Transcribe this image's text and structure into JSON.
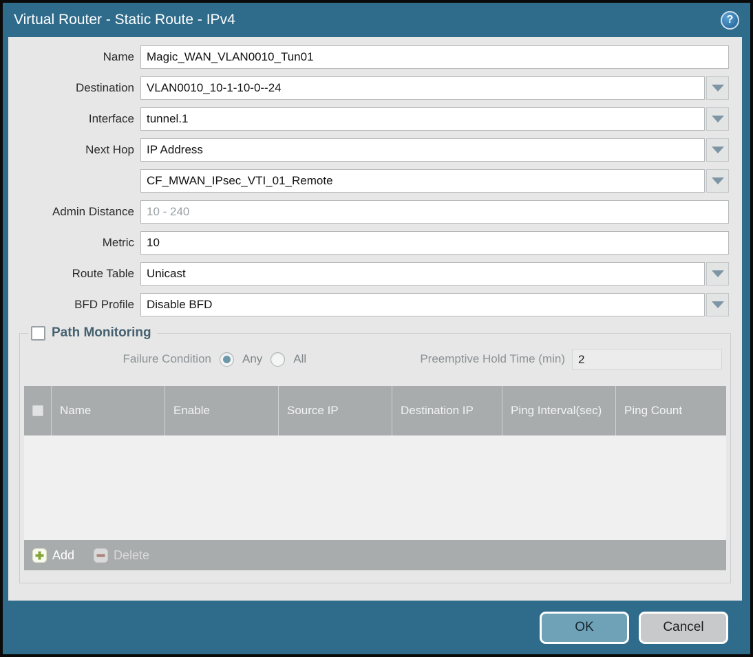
{
  "window": {
    "title": "Virtual Router - Static Route - IPv4",
    "help_icon": "help-icon"
  },
  "form": {
    "fields": [
      {
        "label": "Name",
        "value": "Magic_WAN_VLAN0010_Tun01",
        "type": "text"
      },
      {
        "label": "Destination",
        "value": "VLAN0010_10-1-10-0--24",
        "type": "dropdown"
      },
      {
        "label": "Interface",
        "value": "tunnel.1",
        "type": "dropdown"
      },
      {
        "label": "Next Hop",
        "value": "IP Address",
        "type": "dropdown"
      },
      {
        "label": "",
        "value": "CF_MWAN_IPsec_VTI_01_Remote",
        "type": "dropdown"
      },
      {
        "label": "Admin Distance",
        "value": "",
        "placeholder": "10 - 240",
        "type": "text"
      },
      {
        "label": "Metric",
        "value": "10",
        "type": "text"
      },
      {
        "label": "Route Table",
        "value": "Unicast",
        "type": "dropdown"
      },
      {
        "label": "BFD Profile",
        "value": "Disable BFD",
        "type": "dropdown"
      }
    ]
  },
  "path_monitoring": {
    "title": "Path Monitoring",
    "checked": false,
    "failure_condition_label": "Failure Condition",
    "options": [
      {
        "label": "Any",
        "selected": true
      },
      {
        "label": "All",
        "selected": false
      }
    ],
    "preemptive_label": "Preemptive Hold Time (min)",
    "preemptive_value": "2",
    "table": {
      "columns": [
        "Name",
        "Enable",
        "Source IP",
        "Destination IP",
        "Ping Interval(sec)",
        "Ping Count"
      ],
      "rows": []
    },
    "add_label": "Add",
    "delete_label": "Delete",
    "add_icon": "plus-icon",
    "delete_icon": "minus-icon"
  },
  "footer": {
    "ok_label": "OK",
    "cancel_label": "Cancel"
  },
  "colors": {
    "frame_teal": "#2f6c8c",
    "panel_gray": "#e7e7e7",
    "table_header_gray": "#a9acad",
    "ok_button": "#6fa2b6",
    "cancel_button": "#c7c9cb",
    "pm_title_text": "#45616f",
    "radio_selected_dot": "#6d98ab",
    "add_plus_green": "#84a43b",
    "delete_minus_red": "#b0685f"
  }
}
